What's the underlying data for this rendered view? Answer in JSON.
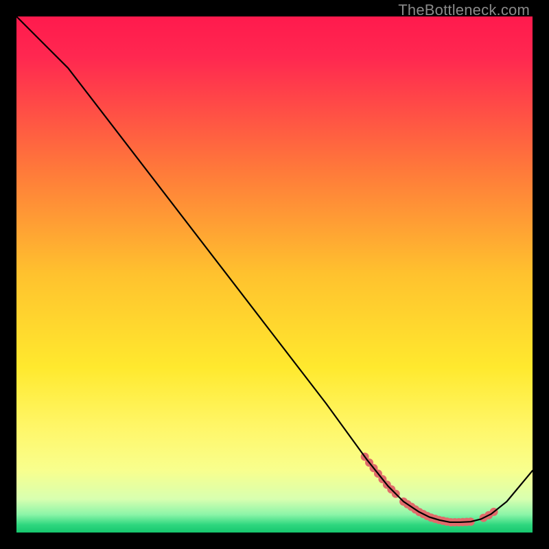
{
  "watermark": "TheBottleneck.com",
  "chart_data": {
    "type": "line",
    "title": "",
    "xlabel": "",
    "ylabel": "",
    "xlim": [
      0,
      100
    ],
    "ylim": [
      0,
      100
    ],
    "grid": false,
    "legend": false,
    "gradient_stops": [
      {
        "offset": 0,
        "color": "#ff1a4d"
      },
      {
        "offset": 0.08,
        "color": "#ff2850"
      },
      {
        "offset": 0.3,
        "color": "#ff7a3a"
      },
      {
        "offset": 0.5,
        "color": "#ffc22e"
      },
      {
        "offset": 0.68,
        "color": "#ffe92e"
      },
      {
        "offset": 0.8,
        "color": "#fff76a"
      },
      {
        "offset": 0.88,
        "color": "#f8ff8e"
      },
      {
        "offset": 0.935,
        "color": "#d8ffb0"
      },
      {
        "offset": 0.965,
        "color": "#8cf5a8"
      },
      {
        "offset": 0.985,
        "color": "#2fd77f"
      },
      {
        "offset": 1.0,
        "color": "#16c76e"
      }
    ],
    "series": [
      {
        "name": "bottleneck-curve",
        "x": [
          0,
          6,
          10,
          20,
          30,
          40,
          50,
          60,
          68,
          72,
          75,
          78,
          80,
          82,
          84,
          86,
          88,
          90,
          92,
          95,
          100
        ],
        "y": [
          100,
          94,
          90,
          77,
          64,
          51,
          38,
          25,
          14,
          9,
          6,
          4,
          3,
          2.4,
          2,
          2,
          2.1,
          2.6,
          3.6,
          6,
          12
        ]
      }
    ],
    "markers": {
      "name": "highlight-dots",
      "color": "#e06b6b",
      "radius": 6,
      "clusters": [
        {
          "x_start": 67.5,
          "x_end": 73.5,
          "count": 8,
          "y_from_curve": true
        },
        {
          "x_start": 75,
          "x_end": 88,
          "count": 18,
          "y_from_curve": true
        },
        {
          "x_start": 90.5,
          "x_end": 92.5,
          "count": 3,
          "y_from_curve": true
        }
      ]
    }
  }
}
